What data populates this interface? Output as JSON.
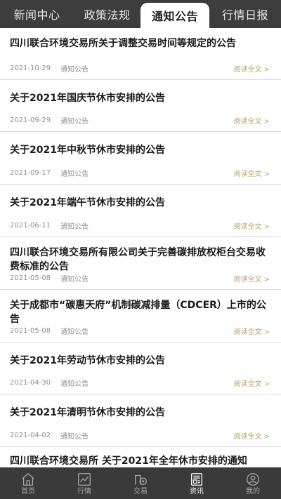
{
  "tabs": [
    {
      "label": "新闻中心",
      "active": false
    },
    {
      "label": "政策法规",
      "active": false
    },
    {
      "label": "通知公告",
      "active": true
    },
    {
      "label": "行情日报",
      "active": false
    }
  ],
  "list": {
    "read_more_label": "阅读全文",
    "items": [
      {
        "title": "四川联合环境交易所关于调整交易时间等规定的公告",
        "date": "2021-10-29",
        "category": "通知公告"
      },
      {
        "title": "关于2021年国庆节休市安排的公告",
        "date": "2021-09-29",
        "category": "通知公告"
      },
      {
        "title": "关于2021年中秋节休市安排的公告",
        "date": "2021-09-17",
        "category": "通知公告"
      },
      {
        "title": "关于2021年端午节休市安排的公告",
        "date": "2021-06-11",
        "category": "通知公告"
      },
      {
        "title": "四川联合环境交易所有限公司关于完善碳排放权柜台交易收费标准的公告",
        "date": "2021-05-08",
        "category": "通知公告"
      },
      {
        "title": "关于成都市“碳惠天府”机制碳减排量（CDCER）上市的公告",
        "date": "2021-05-08",
        "category": "通知公告"
      },
      {
        "title": "关于2021年劳动节休市安排的公告",
        "date": "2021-04-30",
        "category": "通知公告"
      },
      {
        "title": "关于2021年清明节休市安排的公告",
        "date": "2021-04-02",
        "category": "通知公告"
      },
      {
        "title": "四川联合环境交易所 关于2021年全年休市安排的通知",
        "date": "",
        "category": ""
      }
    ]
  },
  "bottom_nav": [
    {
      "label": "首页",
      "icon": "home-icon",
      "active": false
    },
    {
      "label": "行情",
      "icon": "chart-icon",
      "active": false
    },
    {
      "label": "交易",
      "icon": "trade-icon",
      "active": false
    },
    {
      "label": "资讯",
      "icon": "news-icon",
      "active": true
    },
    {
      "label": "我的",
      "icon": "user-icon",
      "active": false
    }
  ],
  "colors": {
    "tabbar_bg": "#3d3d3d",
    "accent_readmore": "#b8a16b",
    "bottomnav_bg": "#3a3a3a"
  }
}
